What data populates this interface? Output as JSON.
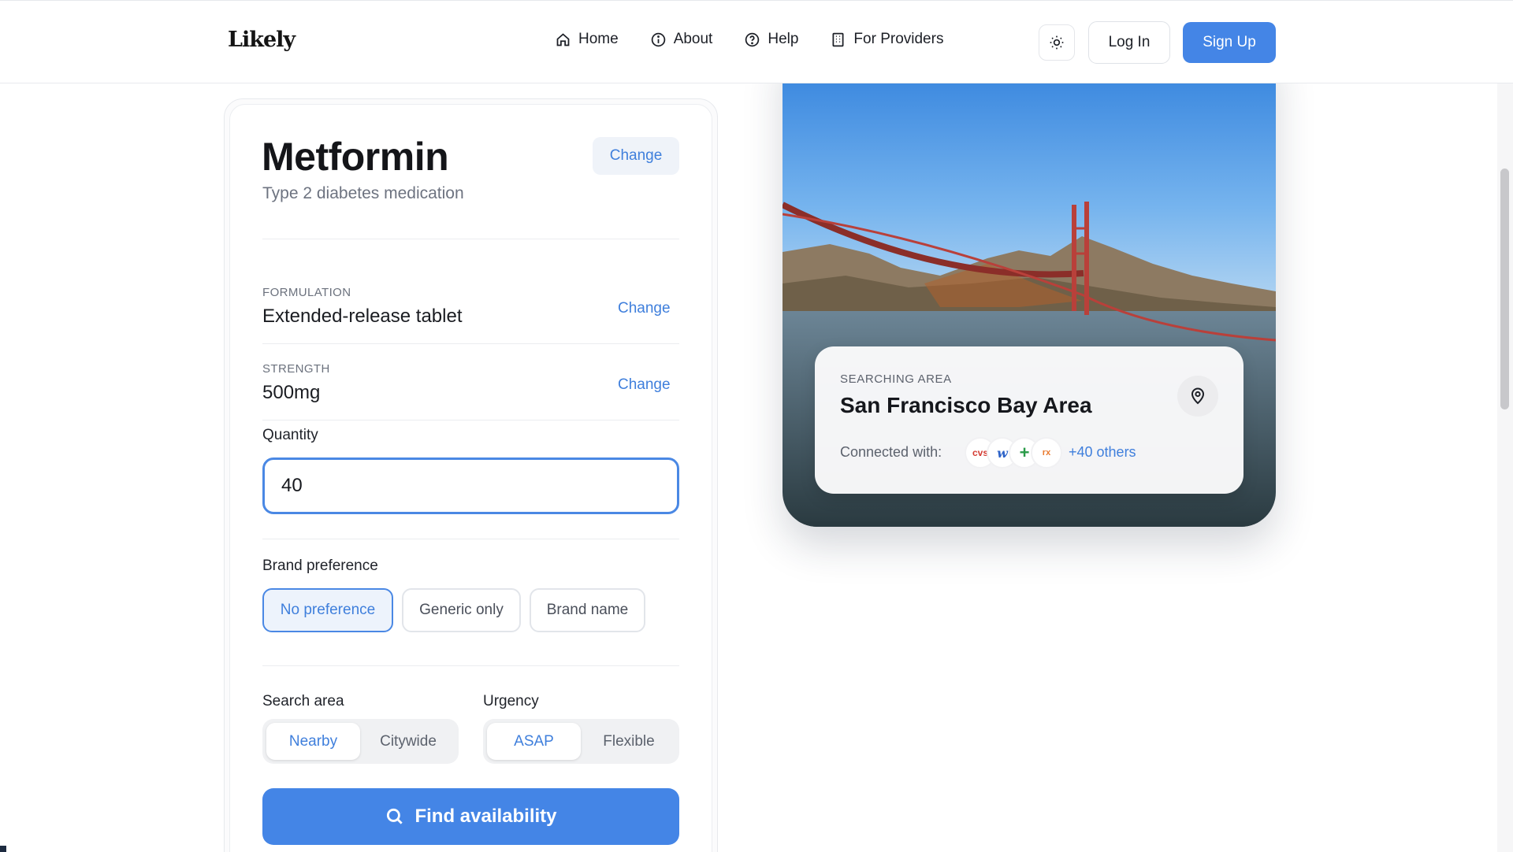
{
  "header": {
    "logo": "Likely",
    "nav": [
      {
        "label": "Home",
        "icon": "home-icon"
      },
      {
        "label": "About",
        "icon": "info-icon"
      },
      {
        "label": "Help",
        "icon": "help-circle-icon"
      },
      {
        "label": "For Providers",
        "icon": "building-icon"
      }
    ],
    "theme_icon": "sun-icon",
    "login_label": "Log In",
    "signup_label": "Sign Up"
  },
  "medication": {
    "name": "Metformin",
    "description": "Type 2 diabetes medication",
    "change_label": "Change",
    "formulation_label": "FORMULATION",
    "formulation_value": "Extended-release tablet",
    "strength_label": "STRENGTH",
    "strength_value": "500mg",
    "field_change_label": "Change"
  },
  "quantity": {
    "label": "Quantity",
    "value": "40"
  },
  "brand": {
    "label": "Brand preference",
    "options": [
      "No preference",
      "Generic only",
      "Brand name"
    ],
    "selected": "No preference"
  },
  "search_area": {
    "label": "Search area",
    "options": [
      "Nearby",
      "Citywide"
    ],
    "selected": "Nearby"
  },
  "urgency": {
    "label": "Urgency",
    "options": [
      "ASAP",
      "Flexible"
    ],
    "selected": "ASAP"
  },
  "find_button": "Find availability",
  "area_card": {
    "label": "SEARCHING AREA",
    "name": "San Francisco Bay Area",
    "connected_label": "Connected with:",
    "pharmacy_logos": [
      "cvs",
      "w",
      "+",
      "rx"
    ],
    "others": "+40 others"
  },
  "colors": {
    "accent": "#4485e6",
    "link": "#3f7fdc"
  }
}
